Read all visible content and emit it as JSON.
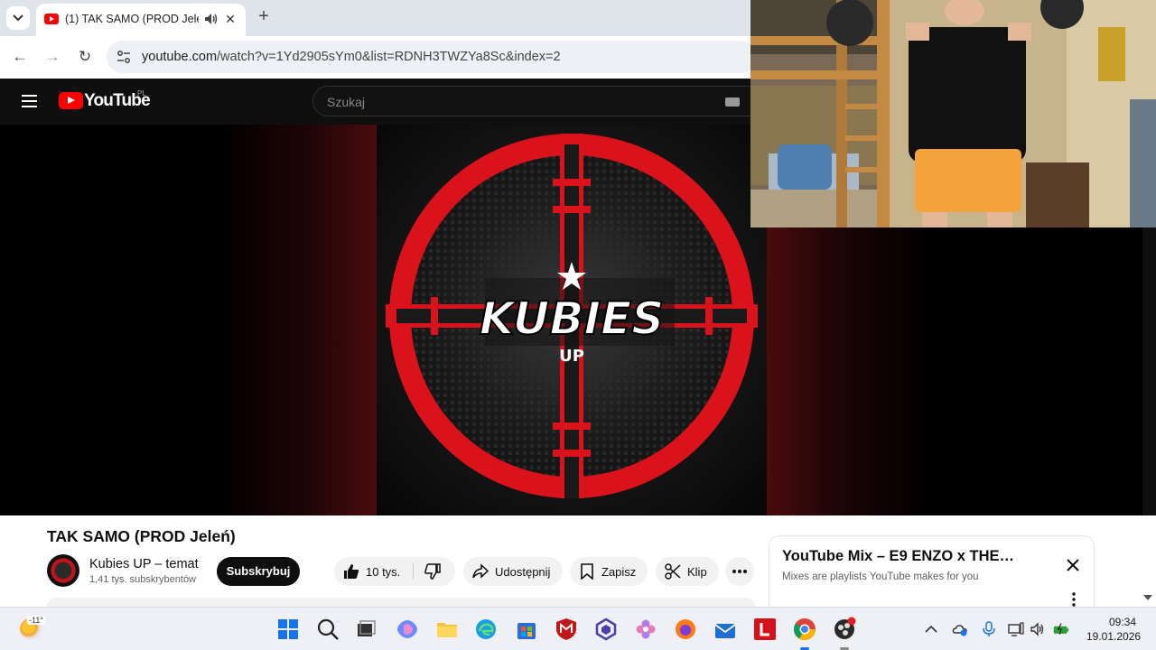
{
  "browser": {
    "tab_title": "(1) TAK SAMO (PROD Jeleń)",
    "url_host": "youtube.com",
    "url_path": "/watch?v=1Yd2905sYm0&list=RDNH3TWZYa8Sc&index=2"
  },
  "youtube": {
    "logo_text": "YouTube",
    "region": "PL",
    "search_placeholder": "Szukaj",
    "thumbnail_text": "KUBIES",
    "thumbnail_subtext": "UP"
  },
  "video": {
    "title": "TAK SAMO (PROD Jeleń)",
    "channel_name": "Kubies UP – temat",
    "channel_subs": "1,41 tys. subskrybentów",
    "subscribe_label": "Subskrybuj",
    "like_count": "10 tys.",
    "share_label": "Udostępnij",
    "save_label": "Zapisz",
    "clip_label": "Klip"
  },
  "mix": {
    "title": "YouTube Mix – E9 ENZO x THE…",
    "subtitle": "Mixes are playlists YouTube makes for you"
  },
  "taskbar": {
    "weather_temp": "-11°",
    "time": "09:34",
    "date": "19.01.2026"
  },
  "colors": {
    "youtube_red": "#ff0000",
    "target_red": "#d9121b",
    "taskbar_bg": "#eef0f5"
  }
}
